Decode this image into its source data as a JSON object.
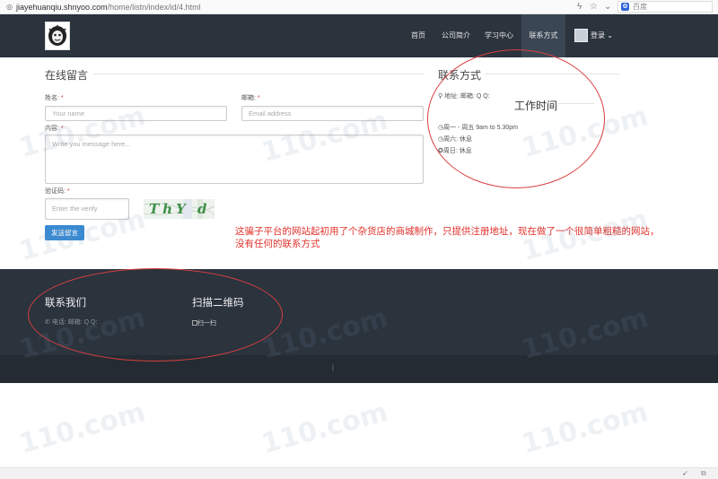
{
  "browser": {
    "url_host": "jiayehuanqiu.shnyoo.com",
    "url_path": "/home/listn/index/id/4.html",
    "search_placeholder": "百度"
  },
  "nav": {
    "items": [
      {
        "label": "首页",
        "active": false
      },
      {
        "label": "公司简介",
        "active": false
      },
      {
        "label": "学习中心",
        "active": false
      },
      {
        "label": "联系方式",
        "active": true
      }
    ],
    "login_label": "登录"
  },
  "message_form": {
    "title": "在线留言",
    "name_label": "姓名:",
    "name_placeholder": "Your name",
    "email_label": "邮箱:",
    "email_placeholder": "Email address",
    "content_label": "内容:",
    "content_placeholder": "Write you message here...",
    "captcha_label": "验证码:",
    "captcha_placeholder": "Enter the verify",
    "captcha_text": "ThY d",
    "required_mark": "*",
    "submit_label": "发送留言"
  },
  "contact": {
    "title": "联系方式",
    "address_line": "地址:  邮箱:  Q Q:",
    "work_time_title": "工作时间",
    "hours": [
      "周一 - 周五  9am to 5.30pm",
      "周六: 休息",
      "周日: 休息"
    ]
  },
  "annotation": "这骗子平台的网站起初用了个杂货店的商城制作，只提供注册地址，现在做了一个很简单粗糙的网站，没有任何的联系方式",
  "footer": {
    "contact_title": "联系我们",
    "contact_info": "电话:  邮箱:  Q Q:",
    "qr_title": "扫描二维码",
    "qr_alt": "扫一扫",
    "bottom_mark": "|"
  },
  "watermark": "110.com",
  "colors": {
    "nav_bg": "#2b333d",
    "accent": "#3a8ad2",
    "annotation": "#e0312b"
  }
}
